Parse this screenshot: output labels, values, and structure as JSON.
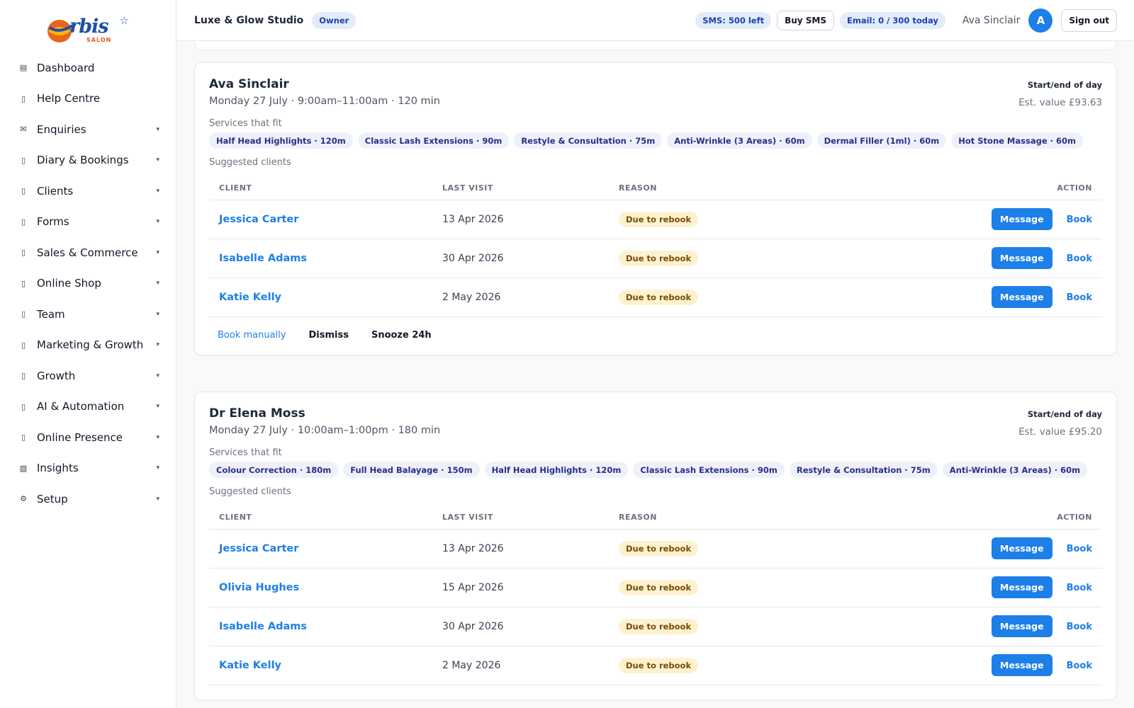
{
  "brand": {
    "logo_text": "rbis",
    "logo_sub": "SALON"
  },
  "sidebar": {
    "items": [
      {
        "icon": "▤",
        "icon_name": "dashboard-icon",
        "label": "Dashboard",
        "caret": ""
      },
      {
        "icon": "▯",
        "icon_name": "help-icon",
        "label": "Help Centre",
        "caret": ""
      },
      {
        "icon": "✉",
        "icon_name": "envelope-icon",
        "label": "Enquiries",
        "caret": "▾"
      },
      {
        "icon": "▯",
        "icon_name": "calendar-icon",
        "label": "Diary & Bookings",
        "caret": "▾"
      },
      {
        "icon": "▯",
        "icon_name": "clients-icon",
        "label": "Clients",
        "caret": "▾"
      },
      {
        "icon": "▯",
        "icon_name": "forms-icon",
        "label": "Forms",
        "caret": "▾"
      },
      {
        "icon": "▯",
        "icon_name": "sales-icon",
        "label": "Sales & Commerce",
        "caret": "▾"
      },
      {
        "icon": "▯",
        "icon_name": "shop-icon",
        "label": "Online Shop",
        "caret": "▾"
      },
      {
        "icon": "▯",
        "icon_name": "team-icon",
        "label": "Team",
        "caret": "▾"
      },
      {
        "icon": "▯",
        "icon_name": "marketing-icon",
        "label": "Marketing & Growth",
        "caret": "▾"
      },
      {
        "icon": "▯",
        "icon_name": "growth-icon",
        "label": "Growth",
        "caret": "▾"
      },
      {
        "icon": "▯",
        "icon_name": "automation-icon",
        "label": "AI & Automation",
        "caret": "▾"
      },
      {
        "icon": "▯",
        "icon_name": "globe-icon",
        "label": "Online Presence",
        "caret": "▾"
      },
      {
        "icon": "▧",
        "icon_name": "insights-icon",
        "label": "Insights",
        "caret": "▾"
      },
      {
        "icon": "⚙",
        "icon_name": "gear-icon",
        "label": "Setup",
        "caret": "▾"
      }
    ]
  },
  "header": {
    "studio": "Luxe & Glow Studio",
    "role": "Owner",
    "sms": "SMS: 500 left",
    "buy_sms": "Buy SMS",
    "email": "Email: 0 / 300 today",
    "user": "Ava Sinclair",
    "avatar": "A",
    "sign_out": "Sign out"
  },
  "labels": {
    "start_end": "Start/end of day",
    "services": "Services that fit",
    "suggested": "Suggested clients",
    "col_client": "CLIENT",
    "col_last_visit": "LAST VISIT",
    "col_reason": "REASON",
    "col_action": "ACTION",
    "message": "Message",
    "book": "Book",
    "book_manually": "Book manually",
    "dismiss": "Dismiss",
    "snooze": "Snooze 24h"
  },
  "cards": [
    {
      "name": "Ava Sinclair",
      "slot": "Monday 27 July · 9:00am–11:00am · 120 min",
      "est_value": "Est. value £93.63",
      "services": [
        "Half Head Highlights · 120m",
        "Classic Lash Extensions · 90m",
        "Restyle & Consultation · 75m",
        "Anti-Wrinkle (3 Areas) · 60m",
        "Dermal Filler (1ml) · 60m",
        "Hot Stone Massage · 60m"
      ],
      "clients": [
        {
          "name": "Jessica Carter",
          "last_visit": "13 Apr 2026",
          "reason": "Due to rebook"
        },
        {
          "name": "Isabelle Adams",
          "last_visit": "30 Apr 2026",
          "reason": "Due to rebook"
        },
        {
          "name": "Katie Kelly",
          "last_visit": "2 May 2026",
          "reason": "Due to rebook"
        }
      ]
    },
    {
      "name": "Dr Elena Moss",
      "slot": "Monday 27 July · 10:00am–1:00pm · 180 min",
      "est_value": "Est. value £95.20",
      "services": [
        "Colour Correction · 180m",
        "Full Head Balayage · 150m",
        "Half Head Highlights · 120m",
        "Classic Lash Extensions · 90m",
        "Restyle & Consultation · 75m",
        "Anti-Wrinkle (3 Areas) · 60m"
      ],
      "clients": [
        {
          "name": "Jessica Carter",
          "last_visit": "13 Apr 2026",
          "reason": "Due to rebook"
        },
        {
          "name": "Olivia Hughes",
          "last_visit": "15 Apr 2026",
          "reason": "Due to rebook"
        },
        {
          "name": "Isabelle Adams",
          "last_visit": "30 Apr 2026",
          "reason": "Due to rebook"
        },
        {
          "name": "Katie Kelly",
          "last_visit": "2 May 2026",
          "reason": "Due to rebook"
        }
      ]
    }
  ],
  "colors": {
    "accent": "#1d7fe8",
    "chip_bg": "#eef1fa",
    "reason_bg": "#fdf2d0"
  }
}
